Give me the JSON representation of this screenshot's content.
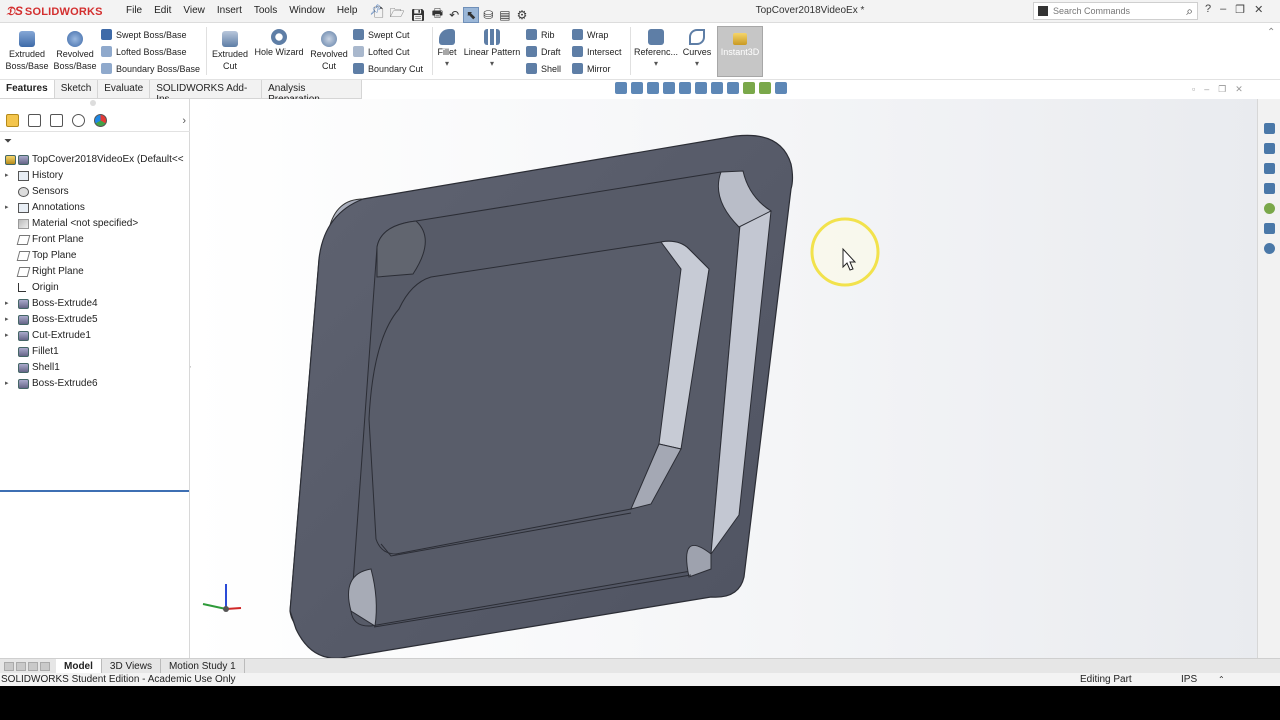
{
  "app": {
    "logo_text": "SOLIDWORKS"
  },
  "menu": [
    "File",
    "Edit",
    "View",
    "Insert",
    "Tools",
    "Window",
    "Help"
  ],
  "document_title": "TopCover2018VideoEx *",
  "search": {
    "placeholder": "Search Commands"
  },
  "command_manager": {
    "extruded_boss": {
      "line1": "Extruded",
      "line2": "Boss/Base"
    },
    "revolved_boss": {
      "line1": "Revolved",
      "line2": "Boss/Base"
    },
    "swept_boss": "Swept Boss/Base",
    "lofted_boss": "Lofted Boss/Base",
    "boundary_boss": "Boundary Boss/Base",
    "extruded_cut": {
      "line1": "Extruded",
      "line2": "Cut"
    },
    "hole_wizard": "Hole Wizard",
    "revolved_cut": {
      "line1": "Revolved",
      "line2": "Cut"
    },
    "swept_cut": "Swept Cut",
    "lofted_cut": "Lofted Cut",
    "boundary_cut": "Boundary Cut",
    "fillet": "Fillet",
    "linear_pattern": "Linear Pattern",
    "rib": "Rib",
    "draft": "Draft",
    "shell": "Shell",
    "wrap": "Wrap",
    "intersect": "Intersect",
    "mirror": "Mirror",
    "reference": "Referenc...",
    "curves": "Curves",
    "instant3d": "Instant3D"
  },
  "tabs": [
    {
      "label": "Features",
      "active": true
    },
    {
      "label": "Sketch"
    },
    {
      "label": "Evaluate"
    },
    {
      "label": "SOLIDWORKS Add-Ins"
    },
    {
      "label": "Analysis Preparation"
    }
  ],
  "feature_tree": {
    "root": "TopCover2018VideoEx  (Default<<",
    "items": [
      {
        "label": "History",
        "icon": "folder-icon",
        "expandable": true
      },
      {
        "label": "Sensors",
        "icon": "sensor-icon",
        "expandable": false
      },
      {
        "label": "Annotations",
        "icon": "annotation-icon",
        "expandable": true
      },
      {
        "label": "Material <not specified>",
        "icon": "material-icon",
        "expandable": false
      },
      {
        "label": "Front Plane",
        "icon": "plane-icon",
        "expandable": false
      },
      {
        "label": "Top Plane",
        "icon": "plane-icon",
        "expandable": false
      },
      {
        "label": "Right Plane",
        "icon": "plane-icon",
        "expandable": false
      },
      {
        "label": "Origin",
        "icon": "origin-icon",
        "expandable": false
      },
      {
        "label": "Boss-Extrude4",
        "icon": "extrude-icon",
        "expandable": true
      },
      {
        "label": "Boss-Extrude5",
        "icon": "extrude-icon",
        "expandable": true
      },
      {
        "label": "Cut-Extrude1",
        "icon": "cut-icon",
        "expandable": true
      },
      {
        "label": "Fillet1",
        "icon": "fillet-icon",
        "expandable": false
      },
      {
        "label": "Shell1",
        "icon": "shell-icon",
        "expandable": false
      },
      {
        "label": "Boss-Extrude6",
        "icon": "extrude-icon",
        "expandable": true
      }
    ]
  },
  "bottom_tabs": [
    {
      "label": "Model",
      "active": true
    },
    {
      "label": "3D Views"
    },
    {
      "label": "Motion Study 1"
    }
  ],
  "status": {
    "edition": "SOLIDWORKS Student Edition - Academic Use Only",
    "mode": "Editing Part",
    "units": "IPS"
  },
  "colors": {
    "brand": "#d32f2f",
    "part": "#5b5f6b",
    "highlight": "#f5ea6a"
  }
}
